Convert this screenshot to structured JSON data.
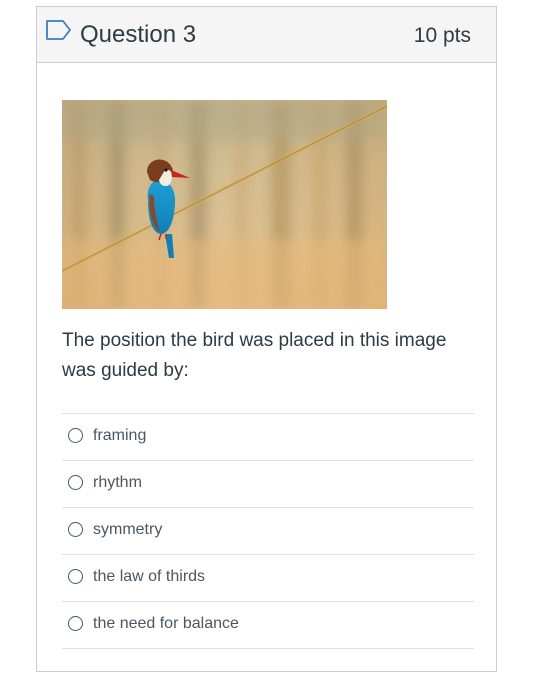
{
  "question": {
    "title": "Question 3",
    "points": "10 pts",
    "prompt": "The position the bird was placed in this image was guided by:",
    "image_subject": "kingfisher perched on a diagonal wire"
  },
  "answers": [
    {
      "label": "framing",
      "selected": false
    },
    {
      "label": "rhythm",
      "selected": false
    },
    {
      "label": "symmetry",
      "selected": false
    },
    {
      "label": "the law of thirds",
      "selected": false
    },
    {
      "label": "the need for balance",
      "selected": false
    }
  ],
  "colors": {
    "flag_icon": "#3b7cc4",
    "header_bg": "#f5f5f5",
    "border": "#c7cdd1",
    "text": "#2d3b45",
    "answer_text": "#4a5761"
  }
}
